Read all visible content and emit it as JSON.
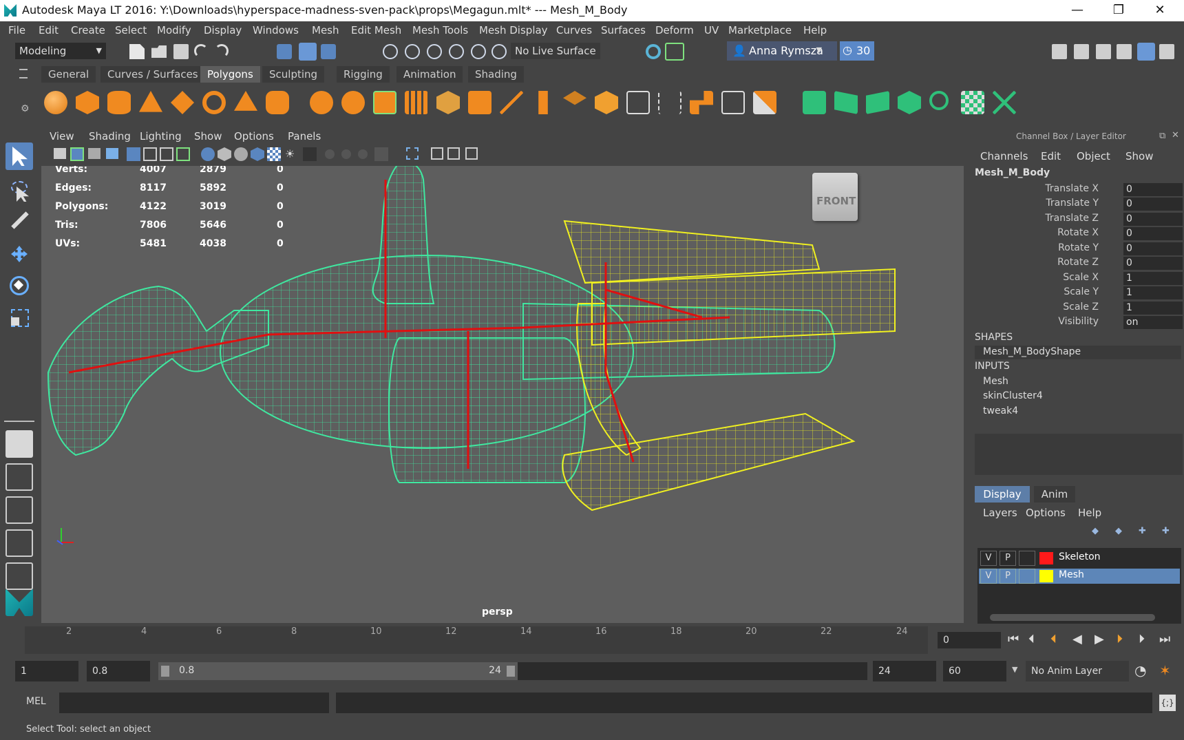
{
  "window": {
    "title": "Autodesk Maya LT 2016: Y:\\Downloads\\hyperspace-madness-sven-pack\\props\\Megagun.mlt*   ---   Mesh_M_Body",
    "minimize": "—",
    "maximize": "❐",
    "close": "✕"
  },
  "menubar": [
    "File",
    "Edit",
    "Create",
    "Select",
    "Modify",
    "Display",
    "Windows",
    "Mesh",
    "Edit Mesh",
    "Mesh Tools",
    "Mesh Display",
    "Curves",
    "Surfaces",
    "Deform",
    "UV",
    "Marketplace",
    "Help"
  ],
  "statusline": {
    "mode": "Modeling",
    "live_surface": "No Live Surface",
    "user": "Anna Rymsza",
    "notifications": "30"
  },
  "shelf": {
    "tabs": [
      "General",
      "Curves / Surfaces",
      "Polygons",
      "Sculpting",
      "Rigging",
      "Animation",
      "Shading"
    ],
    "active_tab": "Polygons"
  },
  "viewport": {
    "menu": [
      "View",
      "Shading",
      "Lighting",
      "Show",
      "Options",
      "Panels"
    ],
    "hud": [
      {
        "label": "Verts:",
        "a": "4007",
        "b": "2879",
        "c": "0"
      },
      {
        "label": "Edges:",
        "a": "8117",
        "b": "5892",
        "c": "0"
      },
      {
        "label": "Polygons:",
        "a": "4122",
        "b": "3019",
        "c": "0"
      },
      {
        "label": "Tris:",
        "a": "7806",
        "b": "5646",
        "c": "0"
      },
      {
        "label": "UVs:",
        "a": "5481",
        "b": "4038",
        "c": "0"
      }
    ],
    "camera": "persp",
    "viewcube": "FRONT",
    "colors": {
      "mesh_green": "#3fe8a0",
      "mesh_yellow": "#f0f020",
      "skeleton": "#e01010"
    }
  },
  "channelbox": {
    "header": "Channel Box / Layer Editor",
    "menu": [
      "Channels",
      "Edit",
      "Object",
      "Show"
    ],
    "object": "Mesh_M_Body",
    "channels": [
      {
        "label": "Translate X",
        "value": "0"
      },
      {
        "label": "Translate Y",
        "value": "0"
      },
      {
        "label": "Translate Z",
        "value": "0"
      },
      {
        "label": "Rotate X",
        "value": "0"
      },
      {
        "label": "Rotate Y",
        "value": "0"
      },
      {
        "label": "Rotate Z",
        "value": "0"
      },
      {
        "label": "Scale X",
        "value": "1"
      },
      {
        "label": "Scale Y",
        "value": "1"
      },
      {
        "label": "Scale Z",
        "value": "1"
      },
      {
        "label": "Visibility",
        "value": "on"
      }
    ],
    "shapes_header": "SHAPES",
    "shape": "Mesh_M_BodyShape",
    "inputs_header": "INPUTS",
    "inputs": [
      "Mesh",
      "skinCluster4",
      "tweak4"
    ]
  },
  "layereditor": {
    "tabs": [
      "Display",
      "Anim"
    ],
    "menu": [
      "Layers",
      "Options",
      "Help"
    ],
    "layers": [
      {
        "v": "V",
        "p": "P",
        "name": "Skeleton",
        "color": "#ff1a1a"
      },
      {
        "v": "V",
        "p": "P",
        "name": "Mesh",
        "color": "#ffff00"
      }
    ]
  },
  "timeslider": {
    "ticks": [
      "2",
      "4",
      "6",
      "8",
      "10",
      "12",
      "14",
      "16",
      "18",
      "20",
      "22",
      "24"
    ],
    "current_frame": "0"
  },
  "range": {
    "start": "1",
    "anim_start": "0.8",
    "range_start": "0.8",
    "range_end": "24",
    "end": "24",
    "anim_end": "60",
    "anim_layer": "No Anim Layer"
  },
  "cmdline": {
    "lang": "MEL"
  },
  "helpline": "Select Tool: select an object"
}
